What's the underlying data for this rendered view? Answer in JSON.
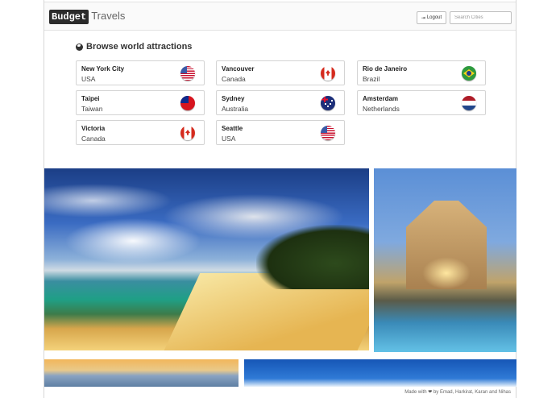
{
  "header": {
    "brand_box": "Budget",
    "brand_rest": "Travels",
    "logout_label": "Logout",
    "search_placeholder": "Search Cities"
  },
  "main": {
    "heading": "Browse world attractions",
    "cities": [
      {
        "city": "New York City",
        "country": "USA",
        "flag": "us-flag-icon"
      },
      {
        "city": "Vancouver",
        "country": "Canada",
        "flag": "canada-flag-icon"
      },
      {
        "city": "Rio de Janeiro",
        "country": "Brazil",
        "flag": "brazil-flag-icon"
      },
      {
        "city": "Taipei",
        "country": "Taiwan",
        "flag": "taiwan-flag-icon"
      },
      {
        "city": "Sydney",
        "country": "Australia",
        "flag": "australia-flag-icon"
      },
      {
        "city": "Amsterdam",
        "country": "Netherlands",
        "flag": "netherlands-flag-icon"
      },
      {
        "city": "Victoria",
        "country": "Canada",
        "flag": "canada-flag-icon"
      },
      {
        "city": "Seattle",
        "country": "USA",
        "flag": "us-flag-icon"
      }
    ]
  },
  "gallery": {
    "photos": [
      "tropical-beach-photo",
      "resort-pool-photo",
      "sunset-clouds-photo",
      "blue-sky-photo"
    ]
  },
  "footer": {
    "prefix": "Made with",
    "suffix": "by Emad, Harkirat, Karan and Nihas"
  }
}
